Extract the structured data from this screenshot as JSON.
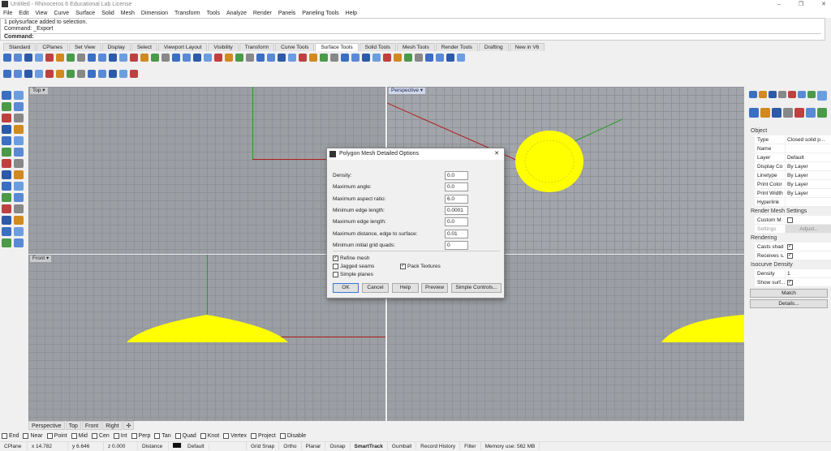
{
  "title": "Untitled - Rhinoceros 6 Educational Lab License",
  "menu": [
    "File",
    "Edit",
    "View",
    "Curve",
    "Surface",
    "Solid",
    "Mesh",
    "Dimension",
    "Transform",
    "Tools",
    "Analyze",
    "Render",
    "Panels",
    "Paneling Tools",
    "Help"
  ],
  "command": {
    "history": [
      "1 polysurface added to selection.",
      "Command: _Export"
    ],
    "prompt": "Command:"
  },
  "toolbar_tabs": [
    "Standard",
    "CPlanes",
    "Set View",
    "Display",
    "Select",
    "Viewport Layout",
    "Visibility",
    "Transform",
    "Curve Tools",
    "Surface Tools",
    "Solid Tools",
    "Mesh Tools",
    "Render Tools",
    "Drafting",
    "New in V6"
  ],
  "active_tab": "Surface Tools",
  "viewports": {
    "top": "Top",
    "perspective": "Perspective",
    "front": "Front"
  },
  "viewport_tabs": [
    "Perspective",
    "Top",
    "Front",
    "Right"
  ],
  "dialog": {
    "title": "Polygon Mesh Detailed Options",
    "fields": [
      {
        "label": "Density:",
        "value": "0.0"
      },
      {
        "label": "Maximum angle:",
        "value": "0.0"
      },
      {
        "label": "Maximum aspect ratio:",
        "value": "6.0"
      },
      {
        "label": "Minimum edge length:",
        "value": "0.0001"
      },
      {
        "label": "Maximum edge length:",
        "value": "0.0"
      },
      {
        "label": "Maximum distance, edge to surface:",
        "value": "0.01"
      },
      {
        "label": "Minimum initial grid quads:",
        "value": "0"
      }
    ],
    "checks": {
      "refine": {
        "label": "Refine mesh",
        "checked": true
      },
      "jagged": {
        "label": "Jagged seams",
        "checked": false
      },
      "pack": {
        "label": "Pack Textures",
        "checked": true
      },
      "simple": {
        "label": "Simple planes",
        "checked": false
      }
    },
    "buttons": {
      "ok": "OK",
      "cancel": "Cancel",
      "help": "Help",
      "preview": "Preview",
      "simple": "Simple Controls..."
    }
  },
  "properties": {
    "object_header": "Object",
    "rows": [
      {
        "k": "Type",
        "v": "Closed solid p..."
      },
      {
        "k": "Name",
        "v": ""
      },
      {
        "k": "Layer",
        "v": "Default"
      },
      {
        "k": "Display Co",
        "v": "By Layer"
      },
      {
        "k": "Linetype",
        "v": "By Layer"
      },
      {
        "k": "Print Color",
        "v": "By Layer"
      },
      {
        "k": "Print Width",
        "v": "By Layer"
      },
      {
        "k": "Hyperlink",
        "v": ""
      }
    ],
    "render_mesh_header": "Render Mesh Settings",
    "custom_mesh": "Custom M",
    "settings": "Settings",
    "adjust": "Adjust...",
    "rendering_header": "Rendering",
    "casts": "Casts shad",
    "receives": "Receives s...",
    "isocurve_header": "Isocurve Density",
    "density_label": "Density",
    "density_value": "1",
    "show_surf": "Show surf...",
    "match": "Match",
    "details": "Details..."
  },
  "osnaps": [
    "End",
    "Near",
    "Point",
    "Mid",
    "Cen",
    "Int",
    "Perp",
    "Tan",
    "Quad",
    "Knot",
    "Vertex",
    "Project",
    "Disable"
  ],
  "status": {
    "cplane": "CPlane",
    "x": "x 14.782",
    "y": "y 6.646",
    "z": "z 0.000",
    "distance": "Distance",
    "layer": "Default",
    "grid_snap": "Grid Snap",
    "ortho": "Ortho",
    "planar": "Planar",
    "osnap": "Osnap",
    "smarttrack": "SmartTrack",
    "gumball": "Gumball",
    "record": "Record History",
    "filter": "Filter",
    "memory": "Memory use: 562 MB"
  },
  "colors": {
    "object": "#ffff00",
    "viewport_bg": "#9b9ea3",
    "x_axis": "#b02020",
    "y_axis": "#2a9a2a"
  }
}
